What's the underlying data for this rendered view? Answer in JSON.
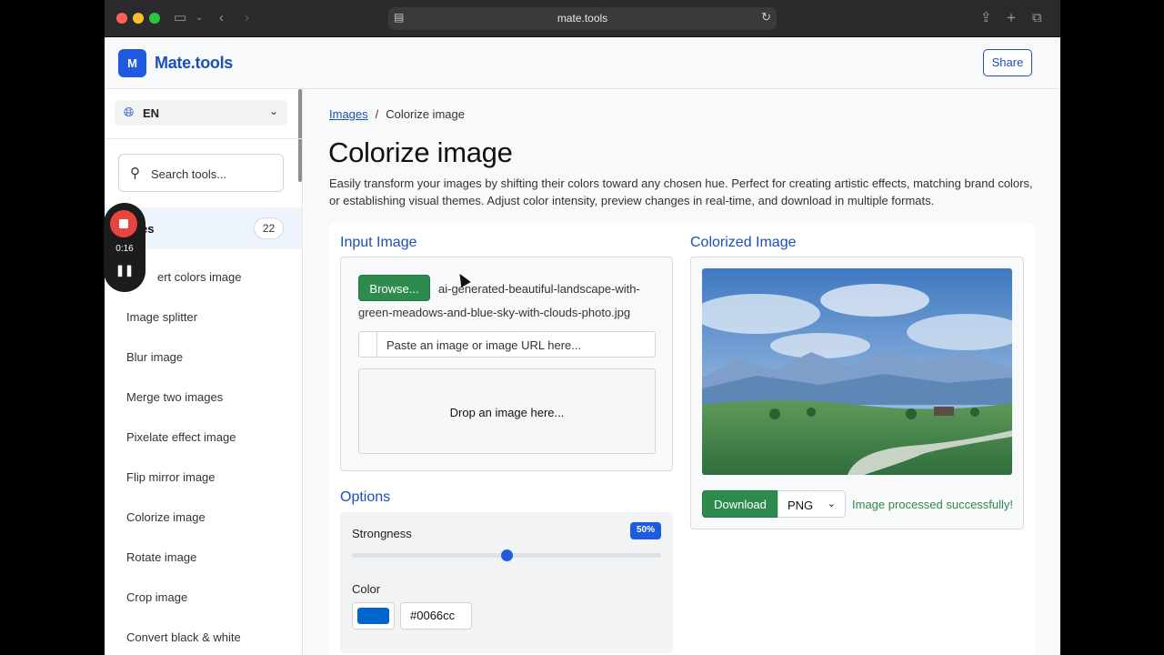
{
  "browser": {
    "url": "mate.tools"
  },
  "header": {
    "logo_letter": "M",
    "brand": "Mate.tools",
    "share_label": "Share"
  },
  "sidebar": {
    "language": "EN",
    "search_placeholder": "Search tools...",
    "category": {
      "label": "es",
      "count": "22"
    },
    "items": [
      "ert colors image",
      "Image splitter",
      "Blur image",
      "Merge two images",
      "Pixelate effect image",
      "Flip mirror image",
      "Colorize image",
      "Rotate image",
      "Crop image",
      "Convert black & white"
    ]
  },
  "recorder": {
    "time": "0:16"
  },
  "main": {
    "breadcrumb": {
      "parent": "Images",
      "separator": "/",
      "current": "Colorize image"
    },
    "title": "Colorize image",
    "description": "Easily transform your images by shifting their colors toward any chosen hue. Perfect for creating artistic effects, matching brand colors, or establishing visual themes. Adjust color intensity, preview changes in real-time, and download in multiple formats.",
    "input": {
      "title": "Input Image",
      "browse_label": "Browse...",
      "filename": "ai-generated-beautiful-landscape-with-green-meadows-and-blue-sky-with-clouds-photo.jpg",
      "paste_placeholder": "Paste an image or image URL here...",
      "drop_text": "Drop an image here..."
    },
    "options": {
      "title": "Options",
      "strongness_label": "Strongness",
      "strongness_value": "50%",
      "strongness_fraction": 0.5,
      "color_label": "Color",
      "color_hex": "#0066cc"
    },
    "output": {
      "title": "Colorized Image",
      "download_label": "Download",
      "format": "PNG",
      "status": "Image processed successfully!"
    }
  },
  "colors": {
    "accent": "#1f5ae0",
    "brand_text": "#1d4fb8",
    "success": "#2e8b4e"
  }
}
